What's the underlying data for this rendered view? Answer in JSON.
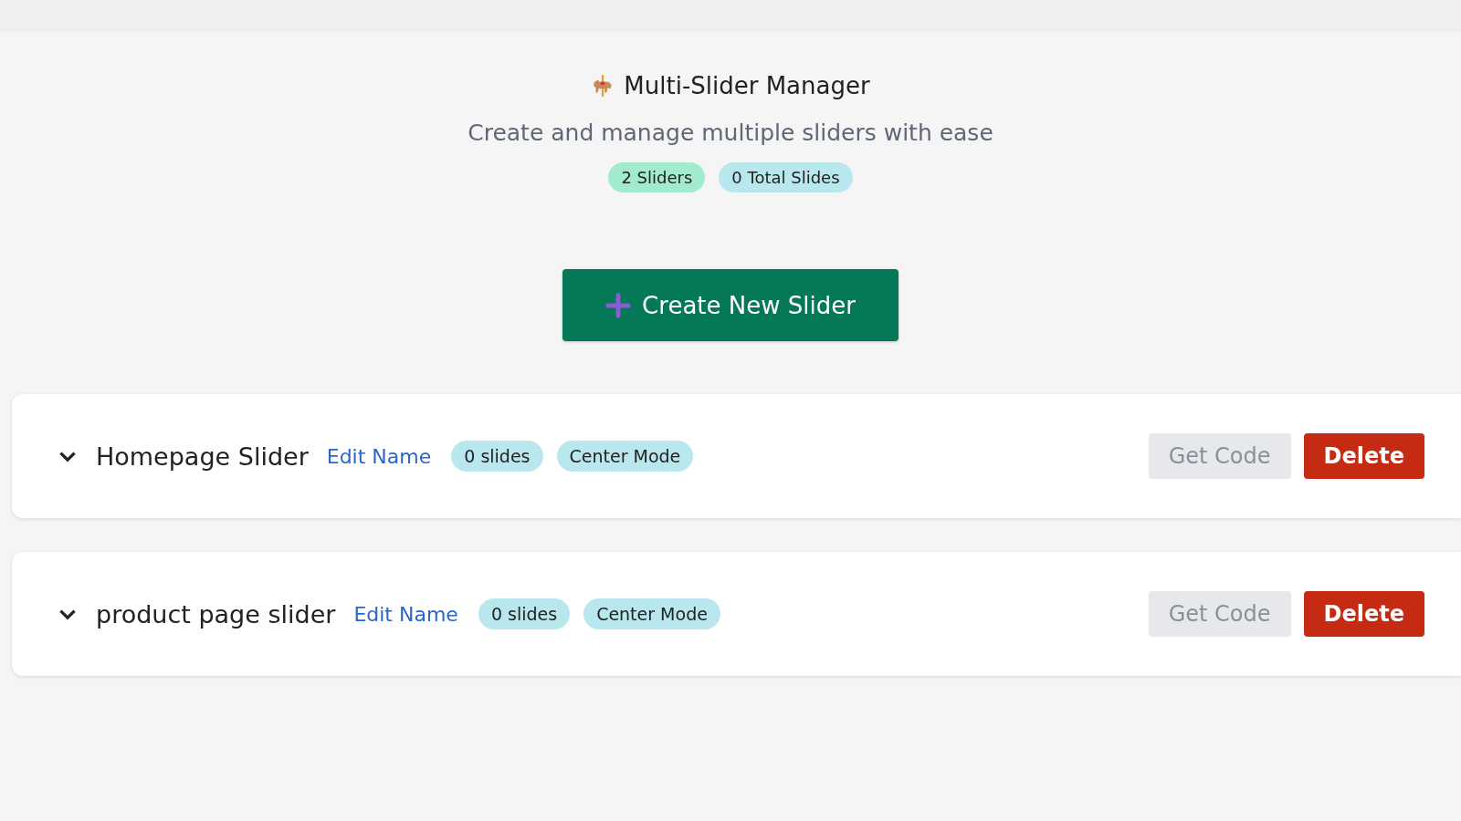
{
  "header": {
    "title": "Multi-Slider Manager",
    "subtitle": "Create and manage multiple sliders with ease",
    "badges": [
      {
        "text": "2 Sliders",
        "color": "#a3ebcf"
      },
      {
        "text": "0 Total Slides",
        "color": "#b8e7ee"
      }
    ]
  },
  "create_button": {
    "label": "Create New Slider"
  },
  "sliders": [
    {
      "name": "Homepage Slider",
      "expanded": false,
      "edit_link": "Edit Name",
      "tags": [
        "0 slides",
        "Center Mode"
      ],
      "get_code": {
        "label": "Get Code",
        "disabled": true
      },
      "delete": "Delete"
    },
    {
      "name": "product page slider",
      "expanded": false,
      "edit_link": "Edit Name",
      "tags": [
        "0 slides",
        "Center Mode"
      ],
      "get_code": {
        "label": "Get Code",
        "disabled": true
      },
      "delete": "Delete"
    }
  ]
}
